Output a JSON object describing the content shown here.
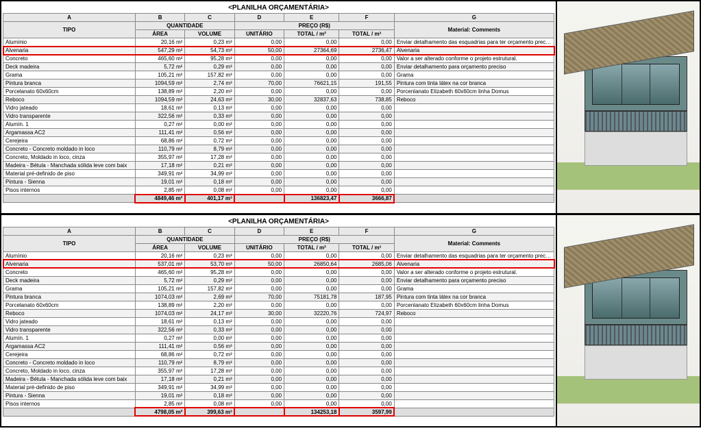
{
  "title": "<PLANILHA ORÇAMENTÁRIA>",
  "letters": [
    "A",
    "B",
    "C",
    "D",
    "E",
    "F",
    "G"
  ],
  "header1": {
    "tipo": "TIPO",
    "quant": "QUANTIDADE",
    "area": "ÁREA",
    "vol": "VOLUME",
    "preco": "PREÇO (R$)",
    "unit": "UNITÁRIO",
    "totM2": "TOTAL / m²",
    "totM3": "TOTAL / m³",
    "mat": "Material: Comments"
  },
  "top": {
    "rows": [
      {
        "tipo": "Alumínio",
        "area": "20,16 m²",
        "vol": "0,23 m³",
        "unit": "0,00",
        "t2": "0,00",
        "t3": "0,00",
        "com": "Enviar detalhamento das esquadrias para ter orçamento preciso"
      },
      {
        "tipo": "Alvenaria",
        "area": "547,29 m²",
        "vol": "54,73 m³",
        "unit": "50,00",
        "t2": "27364,69",
        "t3": "2736,47",
        "com": "Alvenaria",
        "hl": true
      },
      {
        "tipo": "Concreto",
        "area": "465,60 m²",
        "vol": "95,28 m³",
        "unit": "0,00",
        "t2": "0,00",
        "t3": "0,00",
        "com": "Valor a ser alterado conforme o projeto estrutural."
      },
      {
        "tipo": "Deck madeira",
        "area": "5,72 m²",
        "vol": "0,29 m³",
        "unit": "0,00",
        "t2": "0,00",
        "t3": "0,00",
        "com": "Enviar detalhamento para orçamento preciso"
      },
      {
        "tipo": "Grama",
        "area": "105,21 m²",
        "vol": "157,82 m³",
        "unit": "0,00",
        "t2": "0,00",
        "t3": "0,00",
        "com": "Grama"
      },
      {
        "tipo": "Pintura branca",
        "area": "1094,59 m²",
        "vol": "2,74 m³",
        "unit": "70,00",
        "t2": "76621,15",
        "t3": "191,55",
        "com": "Pintura com tinta látex na cor branca"
      },
      {
        "tipo": "Porcelanato 60x60cm",
        "area": "138,89 m²",
        "vol": "2,20 m³",
        "unit": "0,00",
        "t2": "0,00",
        "t3": "0,00",
        "com": "Porcenlanato Elizabeth 60x60cm linha Domus"
      },
      {
        "tipo": "Reboco",
        "area": "1094,59 m²",
        "vol": "24,63 m³",
        "unit": "30,00",
        "t2": "32837,63",
        "t3": "738,85",
        "com": "Reboco"
      },
      {
        "tipo": "Vidro jateado",
        "area": "18,61 m²",
        "vol": "0,13 m³",
        "unit": "0,00",
        "t2": "0,00",
        "t3": "0,00",
        "com": ""
      },
      {
        "tipo": "Vidro transparente",
        "area": "322,56 m²",
        "vol": "0,33 m³",
        "unit": "0,00",
        "t2": "0,00",
        "t3": "0,00",
        "com": ""
      },
      {
        "tipo": "Alumín. 1",
        "area": "0,27 m²",
        "vol": "0,00 m³",
        "unit": "0,00",
        "t2": "0,00",
        "t3": "0,00",
        "com": ""
      },
      {
        "tipo": "Argamassa AC2",
        "area": "111,41 m²",
        "vol": "0,56 m³",
        "unit": "0,00",
        "t2": "0,00",
        "t3": "0,00",
        "com": ""
      },
      {
        "tipo": "Cerejeira",
        "area": "68,86 m²",
        "vol": "0,72 m³",
        "unit": "0,00",
        "t2": "0,00",
        "t3": "0,00",
        "com": ""
      },
      {
        "tipo": "Concreto - Concreto moldado in loco",
        "area": "110,79 m²",
        "vol": "8,79 m³",
        "unit": "0,00",
        "t2": "0,00",
        "t3": "0,00",
        "com": ""
      },
      {
        "tipo": "Concreto, Moldado in loco, cinza",
        "area": "355,97 m²",
        "vol": "17,28 m³",
        "unit": "0,00",
        "t2": "0,00",
        "t3": "0,00",
        "com": ""
      },
      {
        "tipo": "Madeira - Bétula - Manchada sólida leve com baix",
        "area": "17,18 m²",
        "vol": "0,21 m³",
        "unit": "0,00",
        "t2": "0,00",
        "t3": "0,00",
        "com": ""
      },
      {
        "tipo": "Material pré-definido de piso",
        "area": "349,91 m²",
        "vol": "34,99 m³",
        "unit": "0,00",
        "t2": "0,00",
        "t3": "0,00",
        "com": ""
      },
      {
        "tipo": "Pintura - Sienna",
        "area": "19,01 m²",
        "vol": "0,18 m³",
        "unit": "0,00",
        "t2": "0,00",
        "t3": "0,00",
        "com": ""
      },
      {
        "tipo": "Pisos internos",
        "area": "2,85 m²",
        "vol": "0,08 m³",
        "unit": "0,00",
        "t2": "0,00",
        "t3": "0,00",
        "com": ""
      }
    ],
    "total": {
      "area": "4849,46 m²",
      "vol": "401,17 m³",
      "unit": "",
      "t2": "136823,47",
      "t3": "3666,87"
    }
  },
  "bottom": {
    "rows": [
      {
        "tipo": "Alumínio",
        "area": "20,16 m²",
        "vol": "0,23 m³",
        "unit": "0,00",
        "t2": "0,00",
        "t3": "0,00",
        "com": "Enviar detalhamento das esquadrias para ter orçamento preciso"
      },
      {
        "tipo": "Alvenaria",
        "area": "537,01 m²",
        "vol": "53,70 m³",
        "unit": "50,00",
        "t2": "26850,64",
        "t3": "2685,06",
        "com": "Alvenaria",
        "hl": true
      },
      {
        "tipo": "Concreto",
        "area": "465,60 m²",
        "vol": "95,28 m³",
        "unit": "0,00",
        "t2": "0,00",
        "t3": "0,00",
        "com": "Valor a ser alterado conforme o projeto estrutural."
      },
      {
        "tipo": "Deck madeira",
        "area": "5,72 m²",
        "vol": "0,29 m³",
        "unit": "0,00",
        "t2": "0,00",
        "t3": "0,00",
        "com": "Enviar detalhamento para orçamento preciso"
      },
      {
        "tipo": "Grama",
        "area": "105,21 m²",
        "vol": "157,82 m³",
        "unit": "0,00",
        "t2": "0,00",
        "t3": "0,00",
        "com": "Grama"
      },
      {
        "tipo": "Pintura branca",
        "area": "1074,03 m²",
        "vol": "2,69 m³",
        "unit": "70,00",
        "t2": "75181,78",
        "t3": "187,95",
        "com": "Pintura com tinta látex na cor branca"
      },
      {
        "tipo": "Porcelanato 60x60cm",
        "area": "138,89 m²",
        "vol": "2,20 m³",
        "unit": "0,00",
        "t2": "0,00",
        "t3": "0,00",
        "com": "Porcenlanato Elizabeth 60x60cm linha Domus"
      },
      {
        "tipo": "Reboco",
        "area": "1074,03 m²",
        "vol": "24,17 m³",
        "unit": "30,00",
        "t2": "32220,76",
        "t3": "724,97",
        "com": "Reboco"
      },
      {
        "tipo": "Vidro jateado",
        "area": "18,61 m²",
        "vol": "0,13 m³",
        "unit": "0,00",
        "t2": "0,00",
        "t3": "0,00",
        "com": ""
      },
      {
        "tipo": "Vidro transparente",
        "area": "322,56 m²",
        "vol": "0,33 m³",
        "unit": "0,00",
        "t2": "0,00",
        "t3": "0,00",
        "com": ""
      },
      {
        "tipo": "Alumín. 1",
        "area": "0,27 m²",
        "vol": "0,00 m³",
        "unit": "0,00",
        "t2": "0,00",
        "t3": "0,00",
        "com": ""
      },
      {
        "tipo": "Argamassa AC2",
        "area": "111,41 m²",
        "vol": "0,56 m³",
        "unit": "0,00",
        "t2": "0,00",
        "t3": "0,00",
        "com": ""
      },
      {
        "tipo": "Cerejeira",
        "area": "68,86 m²",
        "vol": "0,72 m³",
        "unit": "0,00",
        "t2": "0,00",
        "t3": "0,00",
        "com": ""
      },
      {
        "tipo": "Concreto - Concreto moldado in loco",
        "area": "110,79 m²",
        "vol": "8,79 m³",
        "unit": "0,00",
        "t2": "0,00",
        "t3": "0,00",
        "com": ""
      },
      {
        "tipo": "Concreto, Moldado in loco, cinza",
        "area": "355,97 m²",
        "vol": "17,28 m³",
        "unit": "0,00",
        "t2": "0,00",
        "t3": "0,00",
        "com": ""
      },
      {
        "tipo": "Madeira - Bétula - Manchada sólida leve com baix",
        "area": "17,18 m²",
        "vol": "0,21 m³",
        "unit": "0,00",
        "t2": "0,00",
        "t3": "0,00",
        "com": ""
      },
      {
        "tipo": "Material pré-definido de piso",
        "area": "349,91 m²",
        "vol": "34,99 m³",
        "unit": "0,00",
        "t2": "0,00",
        "t3": "0,00",
        "com": ""
      },
      {
        "tipo": "Pintura - Sienna",
        "area": "19,01 m²",
        "vol": "0,18 m³",
        "unit": "0,00",
        "t2": "0,00",
        "t3": "0,00",
        "com": ""
      },
      {
        "tipo": "Pisos internos",
        "area": "2,85 m²",
        "vol": "0,08 m³",
        "unit": "0,00",
        "t2": "0,00",
        "t3": "0,00",
        "com": ""
      }
    ],
    "total": {
      "area": "4798,05 m²",
      "vol": "399,63 m³",
      "unit": "",
      "t2": "134253,18",
      "t3": "3597,99"
    }
  }
}
